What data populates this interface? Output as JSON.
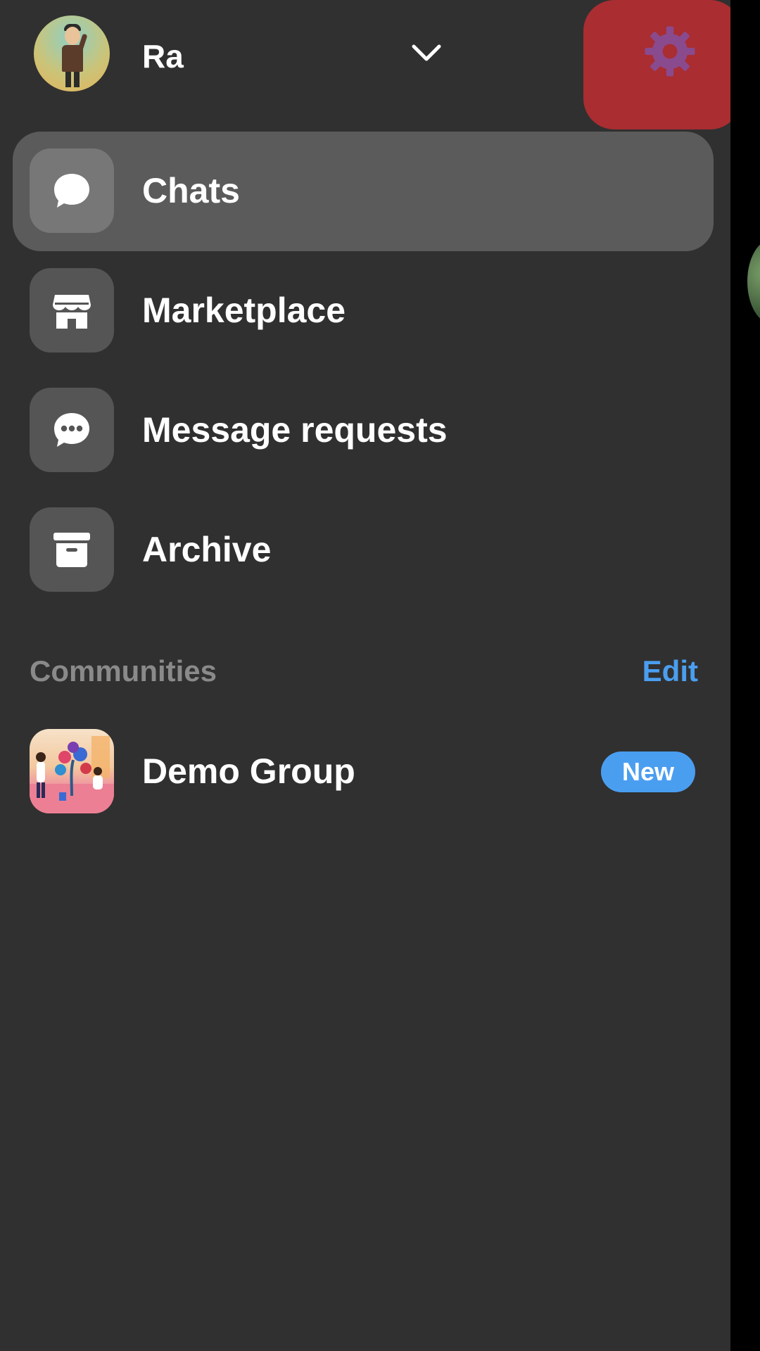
{
  "header": {
    "username": "Ra",
    "chevron_icon": "chevron-down-icon",
    "settings_icon": "gear-icon"
  },
  "menu": {
    "items": [
      {
        "label": "Chats",
        "icon": "chat-bubble-icon",
        "active": true
      },
      {
        "label": "Marketplace",
        "icon": "storefront-icon",
        "active": false
      },
      {
        "label": "Message requests",
        "icon": "message-requests-icon",
        "active": false
      },
      {
        "label": "Archive",
        "icon": "archive-box-icon",
        "active": false
      }
    ]
  },
  "communities": {
    "title": "Communities",
    "edit_label": "Edit",
    "items": [
      {
        "name": "Demo Group",
        "badge": "New"
      }
    ]
  },
  "colors": {
    "background": "#303030",
    "active_item": "#5b5b5b",
    "accent_blue": "#4a9ef0",
    "settings_highlight": "#a92d31",
    "settings_icon": "#8a4a8e"
  }
}
